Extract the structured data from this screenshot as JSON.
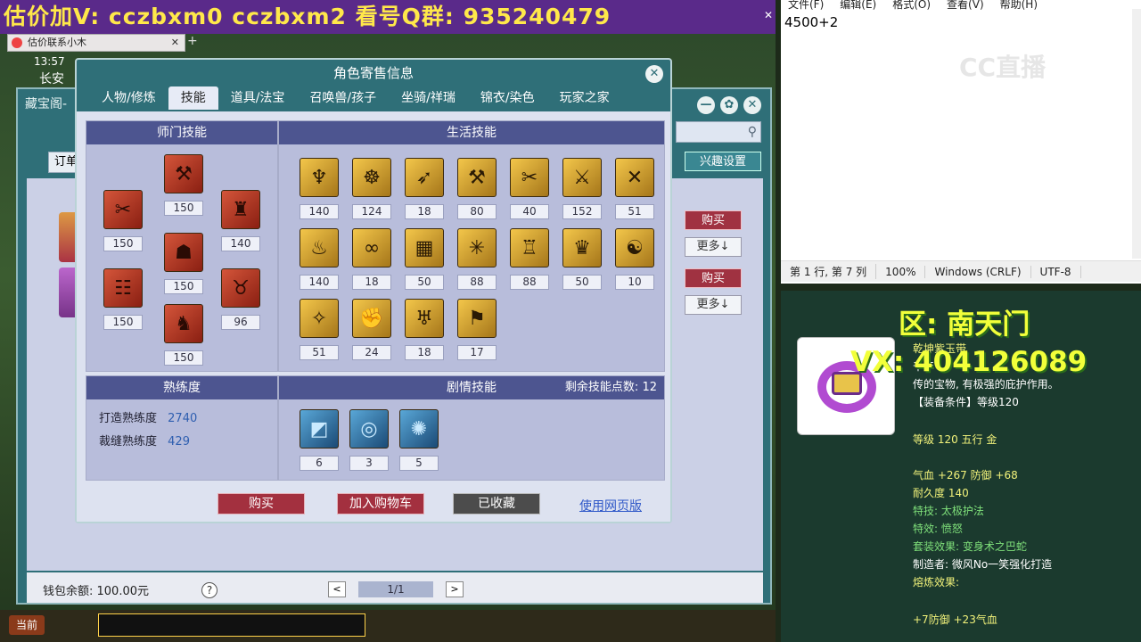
{
  "banner": {
    "text": "估价加V:  cczbxm0   cczbxm2   看号Q群: 935240479",
    "close": "✕"
  },
  "browser": {
    "tab_title": "估价联系小木",
    "tab_close": "✕",
    "tab_add": "+"
  },
  "hud": {
    "time": "13:57",
    "location": "长安"
  },
  "bg_window": {
    "title": "藏宝阁-",
    "order_label": "订单",
    "interest_btn": "兴趣设置",
    "buy_label": "购买",
    "more_label": "更多↓",
    "wallet": "钱包余额: 100.00元",
    "help": "?",
    "pager": {
      "prev": "<",
      "page": "1/1",
      "next": ">"
    },
    "min_btn": "—",
    "max_btn": "✿",
    "close_btn": "✕"
  },
  "dialog": {
    "title": "角色寄售信息",
    "close": "✕",
    "tabs": [
      {
        "label": "人物/修炼"
      },
      {
        "label": "技能"
      },
      {
        "label": "道具/法宝"
      },
      {
        "label": "召唤兽/孩子"
      },
      {
        "label": "坐骑/祥瑞"
      },
      {
        "label": "锦衣/染色"
      },
      {
        "label": "玩家之家"
      }
    ],
    "sect_title": "师门技能",
    "sect_skills": [
      {
        "glyph": "⚒",
        "level": "150"
      },
      {
        "glyph": "☗",
        "level": "150"
      },
      {
        "glyph": "✂",
        "level": "150"
      },
      {
        "glyph": "♜",
        "level": "140"
      },
      {
        "glyph": "☷",
        "level": "150"
      },
      {
        "glyph": "♞",
        "level": "150"
      },
      {
        "glyph": "♉",
        "level": "96"
      }
    ],
    "life_title": "生活技能",
    "life_skills": [
      {
        "glyph": "♆",
        "level": "140"
      },
      {
        "glyph": "☸",
        "level": "124"
      },
      {
        "glyph": "➶",
        "level": "18"
      },
      {
        "glyph": "⚒",
        "level": "80"
      },
      {
        "glyph": "✂",
        "level": "40"
      },
      {
        "glyph": "⚔",
        "level": "152"
      },
      {
        "glyph": "✕",
        "level": "51"
      },
      {
        "glyph": "♨",
        "level": "140"
      },
      {
        "glyph": "∞",
        "level": "18"
      },
      {
        "glyph": "▦",
        "level": "50"
      },
      {
        "glyph": "✳",
        "level": "88"
      },
      {
        "glyph": "♖",
        "level": "88"
      },
      {
        "glyph": "♛",
        "level": "50"
      },
      {
        "glyph": "☯",
        "level": "10"
      },
      {
        "glyph": "✧",
        "level": "51"
      },
      {
        "glyph": "✊",
        "level": "24"
      },
      {
        "glyph": "♅",
        "level": "18"
      },
      {
        "glyph": "⚑",
        "level": "17"
      }
    ],
    "proficiency_title": "熟练度",
    "forge_label": "打造熟练度",
    "forge_value": "2740",
    "tailor_label": "裁缝熟练度",
    "tailor_value": "429",
    "story_title": "剧情技能",
    "remaining_label": "剩余技能点数:",
    "remaining_value": "12",
    "story_skills": [
      {
        "glyph": "◩",
        "level": "6"
      },
      {
        "glyph": "◎",
        "level": "3"
      },
      {
        "glyph": "✺",
        "level": "5"
      }
    ],
    "buttons": {
      "buy": "购买",
      "cart": "加入购物车",
      "favorited": "已收藏",
      "web": "使用网页版"
    }
  },
  "taskbar": {
    "current": "当前"
  },
  "notepad": {
    "menu": [
      "文件(F)",
      "编辑(E)",
      "格式(O)",
      "查看(V)",
      "帮助(H)"
    ],
    "content": "4500+2",
    "watermark": "CC直播",
    "status": {
      "pos": "第 1 行, 第 7 列",
      "zoom": "100%",
      "eol": "Windows (CRLF)",
      "enc": "UTF-8"
    }
  },
  "tooltip": {
    "zone": "区: 南天门",
    "vx": "VX: 404126089",
    "name": "乾坤紫玉带",
    "lines": [
      "千年",
      "传的宝物, 有极强的庇护作用。",
      "【装备条件】等级120"
    ],
    "level_line": "等级 120 五行 金",
    "stats": [
      "气血 +267 防御 +68",
      "耐久度 140",
      "特技: 太极护法",
      "特效: 愤怒",
      "套装效果: 变身术之巴蛇",
      "制造者: 微风No一笑强化打造",
      "熔炼效果:"
    ],
    "smelt": "+7防御 +23气血"
  },
  "colors": {
    "dialog_teal": "#2f6f78",
    "panel_head": "#4d5590",
    "button_red": "#a3303f",
    "banner_yellow": "#ffe84a"
  }
}
